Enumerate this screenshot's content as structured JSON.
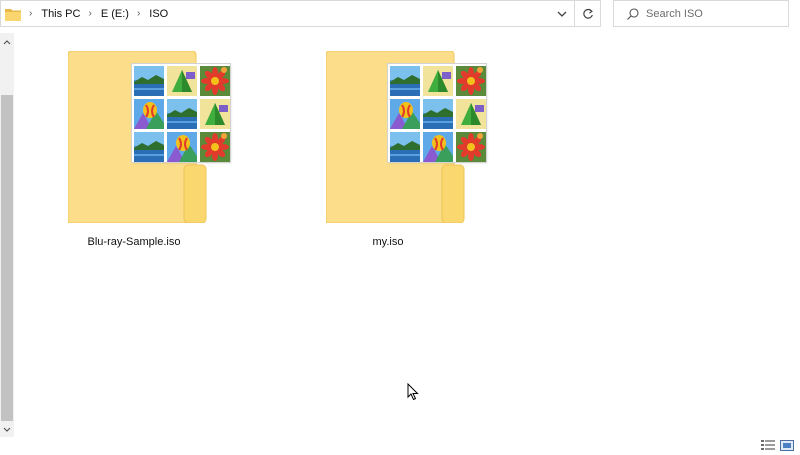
{
  "address_bar": {
    "breadcrumbs": [
      {
        "label": "This PC"
      },
      {
        "label": "E (E:)"
      },
      {
        "label": "ISO"
      }
    ]
  },
  "search": {
    "placeholder": "Search ISO"
  },
  "items": [
    {
      "name": "Blu-ray-Sample.iso",
      "icon": "iso-folder-icon"
    },
    {
      "name": "my.iso",
      "icon": "iso-folder-icon"
    }
  ],
  "colors": {
    "folder_back": "#f5d57a",
    "folder_front": "#fde49b",
    "border": "#d9d9d9",
    "scrollbar_thumb": "#c2c2c2"
  }
}
